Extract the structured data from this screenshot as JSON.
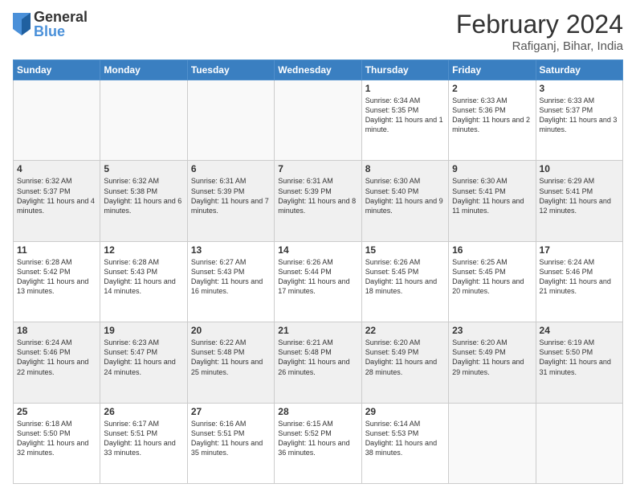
{
  "logo": {
    "general": "General",
    "blue": "Blue"
  },
  "title": {
    "month_year": "February 2024",
    "location": "Rafiganj, Bihar, India"
  },
  "headers": [
    "Sunday",
    "Monday",
    "Tuesday",
    "Wednesday",
    "Thursday",
    "Friday",
    "Saturday"
  ],
  "rows": [
    [
      {
        "day": "",
        "info": ""
      },
      {
        "day": "",
        "info": ""
      },
      {
        "day": "",
        "info": ""
      },
      {
        "day": "",
        "info": ""
      },
      {
        "day": "1",
        "info": "Sunrise: 6:34 AM\nSunset: 5:35 PM\nDaylight: 11 hours and 1 minute."
      },
      {
        "day": "2",
        "info": "Sunrise: 6:33 AM\nSunset: 5:36 PM\nDaylight: 11 hours and 2 minutes."
      },
      {
        "day": "3",
        "info": "Sunrise: 6:33 AM\nSunset: 5:37 PM\nDaylight: 11 hours and 3 minutes."
      }
    ],
    [
      {
        "day": "4",
        "info": "Sunrise: 6:32 AM\nSunset: 5:37 PM\nDaylight: 11 hours and 4 minutes."
      },
      {
        "day": "5",
        "info": "Sunrise: 6:32 AM\nSunset: 5:38 PM\nDaylight: 11 hours and 6 minutes."
      },
      {
        "day": "6",
        "info": "Sunrise: 6:31 AM\nSunset: 5:39 PM\nDaylight: 11 hours and 7 minutes."
      },
      {
        "day": "7",
        "info": "Sunrise: 6:31 AM\nSunset: 5:39 PM\nDaylight: 11 hours and 8 minutes."
      },
      {
        "day": "8",
        "info": "Sunrise: 6:30 AM\nSunset: 5:40 PM\nDaylight: 11 hours and 9 minutes."
      },
      {
        "day": "9",
        "info": "Sunrise: 6:30 AM\nSunset: 5:41 PM\nDaylight: 11 hours and 11 minutes."
      },
      {
        "day": "10",
        "info": "Sunrise: 6:29 AM\nSunset: 5:41 PM\nDaylight: 11 hours and 12 minutes."
      }
    ],
    [
      {
        "day": "11",
        "info": "Sunrise: 6:28 AM\nSunset: 5:42 PM\nDaylight: 11 hours and 13 minutes."
      },
      {
        "day": "12",
        "info": "Sunrise: 6:28 AM\nSunset: 5:43 PM\nDaylight: 11 hours and 14 minutes."
      },
      {
        "day": "13",
        "info": "Sunrise: 6:27 AM\nSunset: 5:43 PM\nDaylight: 11 hours and 16 minutes."
      },
      {
        "day": "14",
        "info": "Sunrise: 6:26 AM\nSunset: 5:44 PM\nDaylight: 11 hours and 17 minutes."
      },
      {
        "day": "15",
        "info": "Sunrise: 6:26 AM\nSunset: 5:45 PM\nDaylight: 11 hours and 18 minutes."
      },
      {
        "day": "16",
        "info": "Sunrise: 6:25 AM\nSunset: 5:45 PM\nDaylight: 11 hours and 20 minutes."
      },
      {
        "day": "17",
        "info": "Sunrise: 6:24 AM\nSunset: 5:46 PM\nDaylight: 11 hours and 21 minutes."
      }
    ],
    [
      {
        "day": "18",
        "info": "Sunrise: 6:24 AM\nSunset: 5:46 PM\nDaylight: 11 hours and 22 minutes."
      },
      {
        "day": "19",
        "info": "Sunrise: 6:23 AM\nSunset: 5:47 PM\nDaylight: 11 hours and 24 minutes."
      },
      {
        "day": "20",
        "info": "Sunrise: 6:22 AM\nSunset: 5:48 PM\nDaylight: 11 hours and 25 minutes."
      },
      {
        "day": "21",
        "info": "Sunrise: 6:21 AM\nSunset: 5:48 PM\nDaylight: 11 hours and 26 minutes."
      },
      {
        "day": "22",
        "info": "Sunrise: 6:20 AM\nSunset: 5:49 PM\nDaylight: 11 hours and 28 minutes."
      },
      {
        "day": "23",
        "info": "Sunrise: 6:20 AM\nSunset: 5:49 PM\nDaylight: 11 hours and 29 minutes."
      },
      {
        "day": "24",
        "info": "Sunrise: 6:19 AM\nSunset: 5:50 PM\nDaylight: 11 hours and 31 minutes."
      }
    ],
    [
      {
        "day": "25",
        "info": "Sunrise: 6:18 AM\nSunset: 5:50 PM\nDaylight: 11 hours and 32 minutes."
      },
      {
        "day": "26",
        "info": "Sunrise: 6:17 AM\nSunset: 5:51 PM\nDaylight: 11 hours and 33 minutes."
      },
      {
        "day": "27",
        "info": "Sunrise: 6:16 AM\nSunset: 5:51 PM\nDaylight: 11 hours and 35 minutes."
      },
      {
        "day": "28",
        "info": "Sunrise: 6:15 AM\nSunset: 5:52 PM\nDaylight: 11 hours and 36 minutes."
      },
      {
        "day": "29",
        "info": "Sunrise: 6:14 AM\nSunset: 5:53 PM\nDaylight: 11 hours and 38 minutes."
      },
      {
        "day": "",
        "info": ""
      },
      {
        "day": "",
        "info": ""
      }
    ]
  ],
  "row_shading": [
    false,
    true,
    false,
    true,
    false
  ]
}
